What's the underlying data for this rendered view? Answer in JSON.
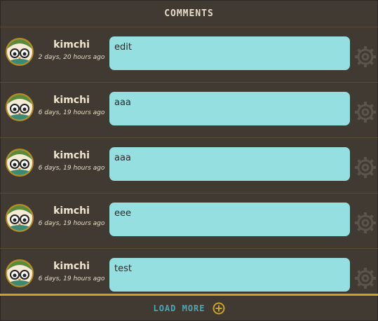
{
  "header": {
    "title": "COMMENTS"
  },
  "comments": [
    {
      "user": "kimchi",
      "time": "2 days, 20 hours ago",
      "text": "edit"
    },
    {
      "user": "kimchi",
      "time": "6 days, 19 hours ago",
      "text": "aaa"
    },
    {
      "user": "kimchi",
      "time": "6 days, 19 hours ago",
      "text": "aaa"
    },
    {
      "user": "kimchi",
      "time": "6 days, 19 hours ago",
      "text": "eee"
    },
    {
      "user": "kimchi",
      "time": "6 days, 19 hours ago",
      "text": "test"
    }
  ],
  "footer": {
    "load_more_label": "LOAD MORE",
    "icon": "plus-circle-icon"
  },
  "icons": {
    "avatar": "owl-avatar-icon",
    "settings": "gear-icon"
  },
  "colors": {
    "background": "#413a33",
    "bubble": "#95dfe0",
    "accent": "#c9a227",
    "load_more": "#4ba7b5"
  }
}
